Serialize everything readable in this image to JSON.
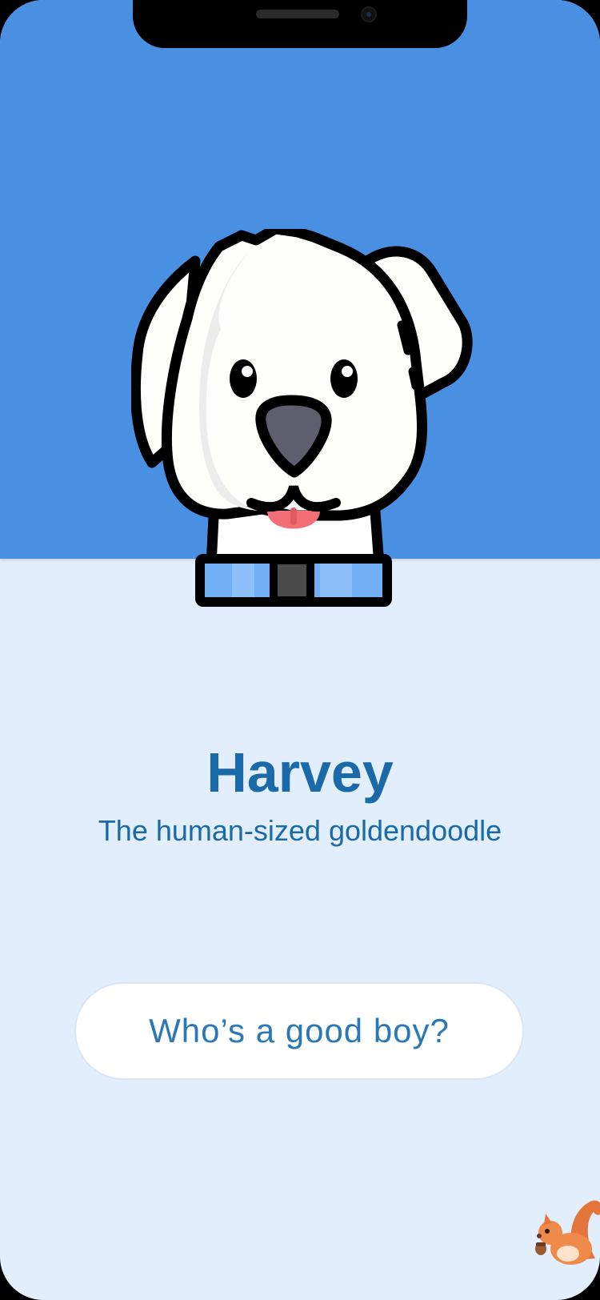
{
  "profile": {
    "name": "Harvey",
    "tagline": "The human-sized goldendoodle"
  },
  "cta": {
    "label": "Who’s a good boy?"
  },
  "icons": {
    "hero": "dog-face-icon",
    "corner": "squirrel-icon"
  },
  "colors": {
    "hero_background": "#4a90e2",
    "page_background": "#e2eefc",
    "text_accent": "#1a69a8",
    "button_background": "#ffffff"
  }
}
